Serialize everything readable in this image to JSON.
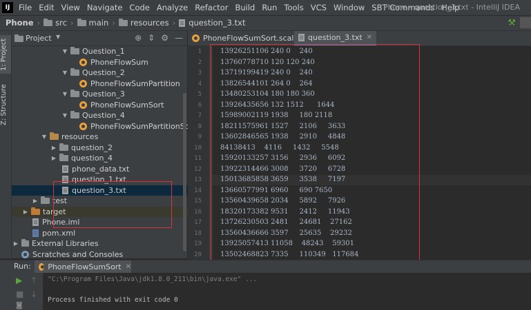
{
  "menubar": {
    "logo_text": "IJ",
    "items": [
      "File",
      "Edit",
      "View",
      "Navigate",
      "Code",
      "Analyze",
      "Refactor",
      "Build",
      "Run",
      "Tools",
      "VCS",
      "Window",
      "SBT Commands",
      "Help"
    ],
    "window_title": "Phone - question_3.txt - IntelliJ IDEA"
  },
  "navbar": {
    "crumbs": [
      "Phone",
      "src",
      "main",
      "resources",
      "question_3.txt"
    ]
  },
  "sidebar_tabs": {
    "project": "1: Project",
    "structure": "Z: Structure"
  },
  "project_panel": {
    "title": "Project",
    "tree": [
      {
        "label": "Question_1",
        "type": "folder"
      },
      {
        "label": "PhoneFlowSum",
        "type": "object"
      },
      {
        "label": "Question_2",
        "type": "folder"
      },
      {
        "label": "PhoneFlowSumPartition",
        "type": "object"
      },
      {
        "label": "Question_3",
        "type": "folder"
      },
      {
        "label": "PhoneFlowSumSort",
        "type": "object"
      },
      {
        "label": "Question_4",
        "type": "folder"
      },
      {
        "label": "PhoneFlowSumPartitionSort",
        "type": "object"
      },
      {
        "label": "resources",
        "type": "folder"
      },
      {
        "label": "question_2",
        "type": "folder"
      },
      {
        "label": "question_4",
        "type": "folder"
      },
      {
        "label": "phone_data.txt",
        "type": "file"
      },
      {
        "label": "question_1.txt",
        "type": "file"
      },
      {
        "label": "question_3.txt",
        "type": "file"
      },
      {
        "label": "test",
        "type": "folder"
      },
      {
        "label": "target",
        "type": "folder"
      },
      {
        "label": "Phone.iml",
        "type": "file"
      },
      {
        "label": "pom.xml",
        "type": "file"
      },
      {
        "label": "External Libraries",
        "type": "library"
      },
      {
        "label": "Scratches and Consoles",
        "type": "scratch"
      }
    ]
  },
  "editor": {
    "tabs": [
      {
        "label": "PhoneFlowSumSort.scala",
        "active": false
      },
      {
        "label": "question_3.txt",
        "active": true
      }
    ],
    "lines": [
      "13926251106 240 0    240",
      "13760778710 120 120 240",
      "13719199419 240 0    240",
      "13826544101 264 0    264",
      "13480253104 180 180 360",
      "13926435656 132 1512      1644",
      "15989002119 1938     180 2118",
      "18211575961 1527     2106     3633",
      "13602846565 1938     2910     4848",
      "84138413    4116     1432     5548",
      "15920133257 3156     2936     6092",
      "13922314466 3008     3720     6728",
      "15013685858 3659     3538     7197",
      "13660577991 6960     690 7650",
      "13560439658 2034     5892     7926",
      "18320173382 9531     2412     11943",
      "13726230503 2481     24681    27162",
      "13560436666 3597     25635    29232",
      "13925057413 11058    48243    59301",
      "13502468823 7335     110349   117684"
    ],
    "current_line": 13
  },
  "run_panel": {
    "label": "Run:",
    "tab": "PhoneFlowSumSort",
    "console": [
      "\"C:\\Program Files\\Java\\jdk1.8.0_211\\bin\\java.exe\" ...",
      "",
      "Process finished with exit code 0"
    ]
  },
  "colors": {
    "accent": "#4a88c7",
    "annotation_red": "#d9333f",
    "run_green": "#5fa43a"
  }
}
